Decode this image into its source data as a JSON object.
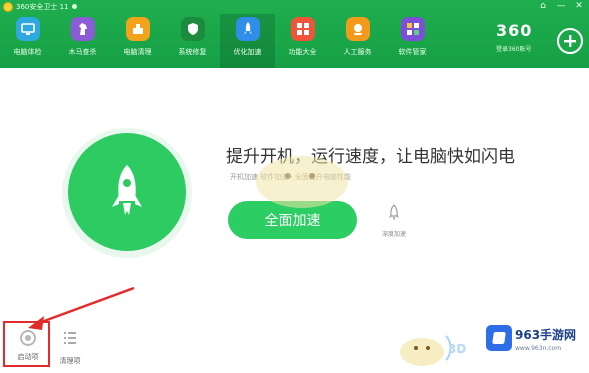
{
  "window": {
    "title": "360安全卫士 11",
    "controls": [
      "⌂",
      "—",
      "✕"
    ]
  },
  "nav": {
    "items": [
      {
        "label": "电脑体检",
        "icon": "monitor-check-icon",
        "color": "#2fa8e0"
      },
      {
        "label": "木马查杀",
        "icon": "horse-icon",
        "color": "#8b5cd6"
      },
      {
        "label": "电脑清理",
        "icon": "broom-icon",
        "color": "#f3a21b"
      },
      {
        "label": "系统修复",
        "icon": "shield-icon",
        "color": "#20a24a"
      },
      {
        "label": "优化加速",
        "icon": "rocket-icon",
        "color": "#2f8ee8",
        "active": true
      },
      {
        "label": "功能大全",
        "icon": "grid-icon",
        "color": "#f0553a"
      },
      {
        "label": "人工服务",
        "icon": "service-icon",
        "color": "#f39a1b"
      },
      {
        "label": "软件管家",
        "icon": "apps-icon",
        "color": "#7d4ed6"
      }
    ]
  },
  "brand": {
    "logo_text": "360",
    "subtitle": "登录360账号",
    "add_icon": "plus-icon"
  },
  "main": {
    "headline": "提升开机，运行速度，让电脑快如闪电",
    "subline": "开机加速 软件加速  · 全面提升电脑性能",
    "speed_button": "全面加速",
    "deep_accel_label": "深度加速",
    "circle_icon": "rocket-icon"
  },
  "bottom_tools": {
    "startup_label": "启动项",
    "clean_label": "清理项"
  },
  "watermark": {
    "site": "963手游网",
    "url": "www.963n.com",
    "mark": "3D"
  },
  "colors": {
    "header_green": "#1fae4f",
    "accent_green": "#2ecb63",
    "highlight_red": "#e32b2b"
  }
}
